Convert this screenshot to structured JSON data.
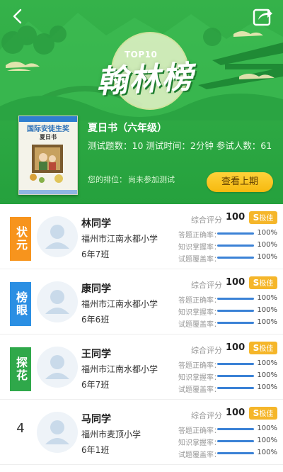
{
  "header": {
    "banner_top": "TOP10",
    "banner_title": "翰林榜",
    "back_icon": "back-arrow-icon",
    "share_icon": "share-icon"
  },
  "book": {
    "cover": {
      "series": "国际安徒生奖",
      "name": "夏日书"
    },
    "title": "夏日书（六年级）",
    "info": "测试题数：10  测试时间：2分钟  参试人数：61",
    "rank_label": "您的排位：",
    "rank_value": "尚未参加测试",
    "last_period_button": "查看上期"
  },
  "metric_labels": {
    "score": "综合评分",
    "accuracy": "答题正确率：",
    "mastery": "知识掌握率：",
    "coverage": "试题覆盖率："
  },
  "rows": [
    {
      "rank_tag": "状元",
      "rank_color": "#f7941d",
      "name": "林同学",
      "school": "福州市江南水都小学",
      "class": "6年7班",
      "score": "100",
      "grade_letter": "S",
      "grade_text": "极佳",
      "accuracy": "100%",
      "mastery": "100%",
      "coverage": "100%",
      "accuracy_value": 1.0,
      "mastery_value": 1.0,
      "coverage_value": 1.0
    },
    {
      "rank_tag": "榜眼",
      "rank_color": "#2b8fe3",
      "name": "康同学",
      "school": "福州市江南水都小学",
      "class": "6年6班",
      "score": "100",
      "grade_letter": "S",
      "grade_text": "极佳",
      "accuracy": "100%",
      "mastery": "100%",
      "coverage": "100%",
      "accuracy_value": 1.0,
      "mastery_value": 1.0,
      "coverage_value": 1.0
    },
    {
      "rank_tag": "探花",
      "rank_color": "#2fa84a",
      "name": "王同学",
      "school": "福州市江南水都小学",
      "class": "6年7班",
      "score": "100",
      "grade_letter": "S",
      "grade_text": "极佳",
      "accuracy": "100%",
      "mastery": "100%",
      "coverage": "100%",
      "accuracy_value": 1.0,
      "mastery_value": 1.0,
      "coverage_value": 1.0
    },
    {
      "rank_number": "4",
      "name": "马同学",
      "school": "福州市麦顶小学",
      "class": "6年1班",
      "score": "100",
      "grade_letter": "S",
      "grade_text": "极佳",
      "accuracy": "100%",
      "mastery": "100%",
      "coverage": "100%",
      "accuracy_value": 1.0,
      "mastery_value": 1.0,
      "coverage_value": 1.0
    }
  ],
  "colors": {
    "header_green": "#2ea944",
    "button_yellow": "#f6b90f",
    "grade_badge": "#f5b62a",
    "progress_blue": "#3b82d6"
  }
}
